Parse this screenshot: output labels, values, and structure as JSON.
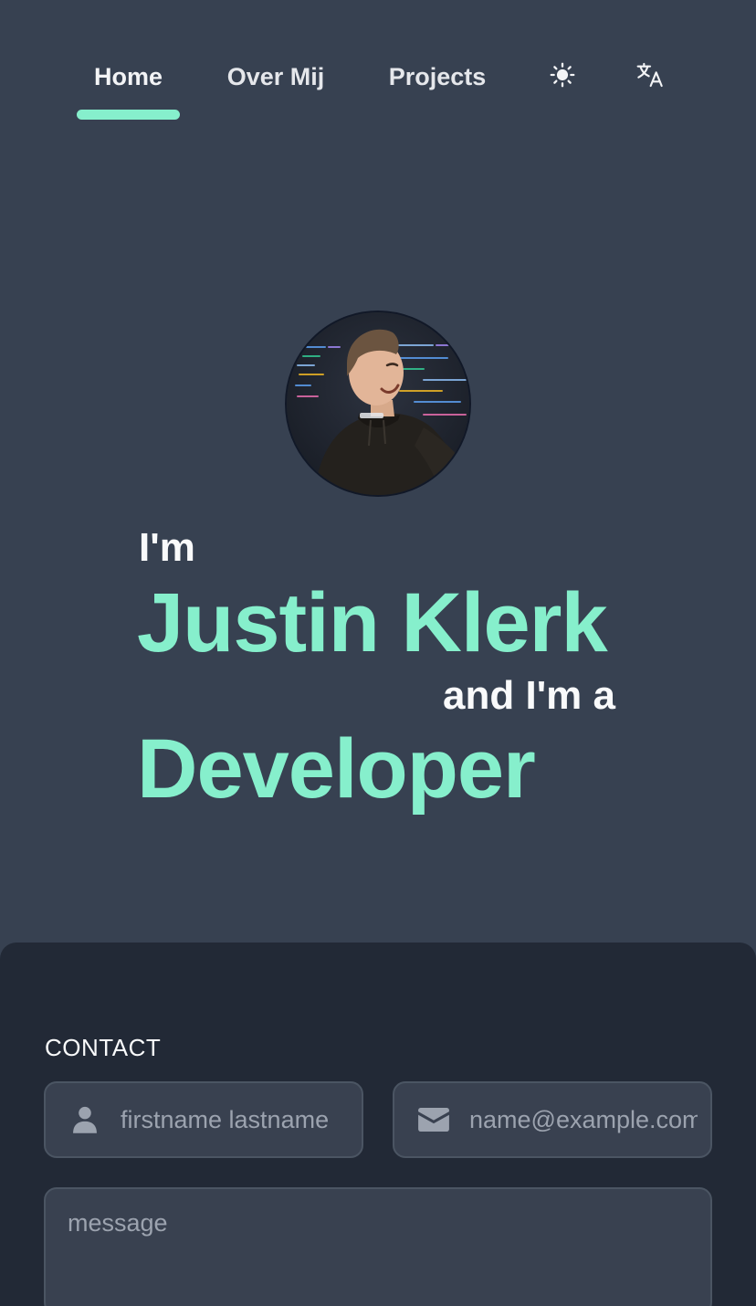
{
  "nav": {
    "items": [
      {
        "label": "Home",
        "active": true
      },
      {
        "label": "Over Mij",
        "active": false
      },
      {
        "label": "Projects",
        "active": false
      }
    ],
    "theme_icon": "sun-icon",
    "language_icon": "translate-icon",
    "active_color": "#86efcc"
  },
  "hero": {
    "prefix": "I'm",
    "name": "Justin Klerk",
    "connector": "and I'm a",
    "role": "Developer",
    "avatar": "profile-photo",
    "accent_color": "#86efcc"
  },
  "contact": {
    "title": "CONTACT",
    "name_placeholder": "firstname lastname",
    "email_placeholder": "name@example.com",
    "message_placeholder": "message",
    "name_icon": "user-icon",
    "email_icon": "envelope-icon"
  }
}
